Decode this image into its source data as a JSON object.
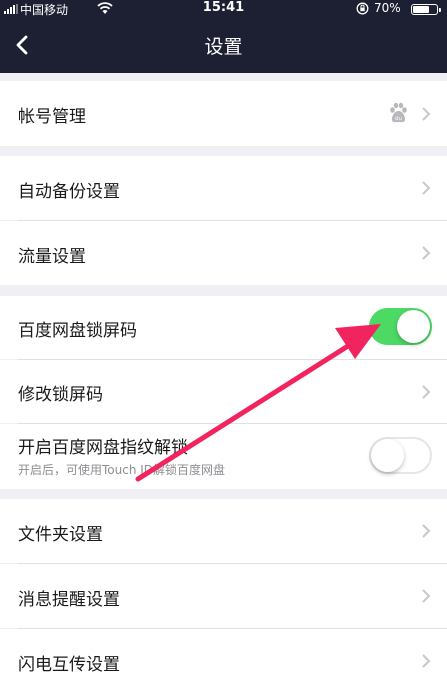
{
  "status_bar": {
    "carrier": "中国移动",
    "time": "15:41",
    "battery_percent": "70%",
    "battery_level": 0.7
  },
  "nav": {
    "title": "设置",
    "back_icon": "chevron-left-icon"
  },
  "settings": {
    "account": {
      "label": "帐号管理",
      "icon": "baidu-paw-icon"
    },
    "auto_backup": {
      "label": "自动备份设置"
    },
    "traffic": {
      "label": "流量设置"
    },
    "lock_screen": {
      "label": "百度网盘锁屏码",
      "enabled": true
    },
    "change_lock": {
      "label": "修改锁屏码"
    },
    "fingerprint": {
      "label": "开启百度网盘指纹解锁",
      "sub": "开启后，可使用Touch ID解锁百度网盘",
      "enabled": false
    },
    "folder": {
      "label": "文件夹设置"
    },
    "notify": {
      "label": "消息提醒设置"
    },
    "transfer": {
      "label": "闪电互传设置"
    }
  },
  "colors": {
    "header_bg": "#1d2033",
    "toggle_on": "#4cd964",
    "annotation_arrow": "#f2245f"
  }
}
